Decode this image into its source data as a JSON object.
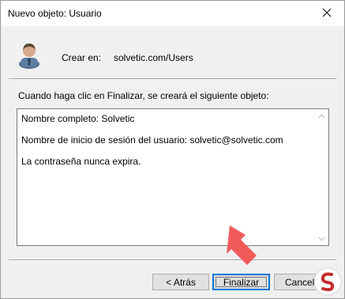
{
  "window": {
    "title": "Nuevo objeto: Usuario"
  },
  "header": {
    "icon": "user-icon",
    "create_in_label": "Crear en:",
    "create_in_value": "solvetic.com/Users"
  },
  "main": {
    "info_text": "Cuando haga clic en Finalizar, se creará el siguiente objeto:",
    "summary_lines": [
      "Nombre completo: Solvetic",
      "Nombre de inicio de sesión del usuario: solvetic@solvetic.com",
      "La contraseña nunca expira."
    ]
  },
  "buttons": {
    "back": "< Atrás",
    "finish": "Finalizar",
    "cancel": "Cancelar"
  },
  "colors": {
    "accent": "#0078d7",
    "arrow": "#f25a5a",
    "dialog_bg": "#f0f0f0"
  }
}
